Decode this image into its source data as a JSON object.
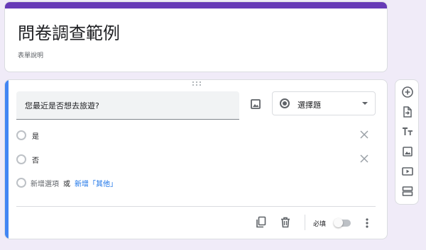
{
  "form": {
    "title": "問卷調查範例",
    "description": "表單說明"
  },
  "question": {
    "text": "您最近是否想去旅遊?",
    "type": "選擇題",
    "options": [
      {
        "label": "是"
      },
      {
        "label": "否"
      }
    ],
    "add_option": "新增選項",
    "or_text": "或",
    "add_other": "新增「其他」",
    "required_label": "必填",
    "required": false
  },
  "colors": {
    "header_accent": "#673ab7",
    "active_question": "#4285f4",
    "link": "#1a73e8",
    "background": "#f0ebf8"
  },
  "icons": {
    "question_image": "image-icon",
    "type_select": "radio-button-icon",
    "duplicate": "copy-icon",
    "delete": "trash-icon",
    "more": "more-vert-icon",
    "toolbar": [
      "add-question-icon",
      "import-questions-icon",
      "add-title-icon",
      "add-image-icon",
      "add-video-icon",
      "add-section-icon"
    ]
  }
}
